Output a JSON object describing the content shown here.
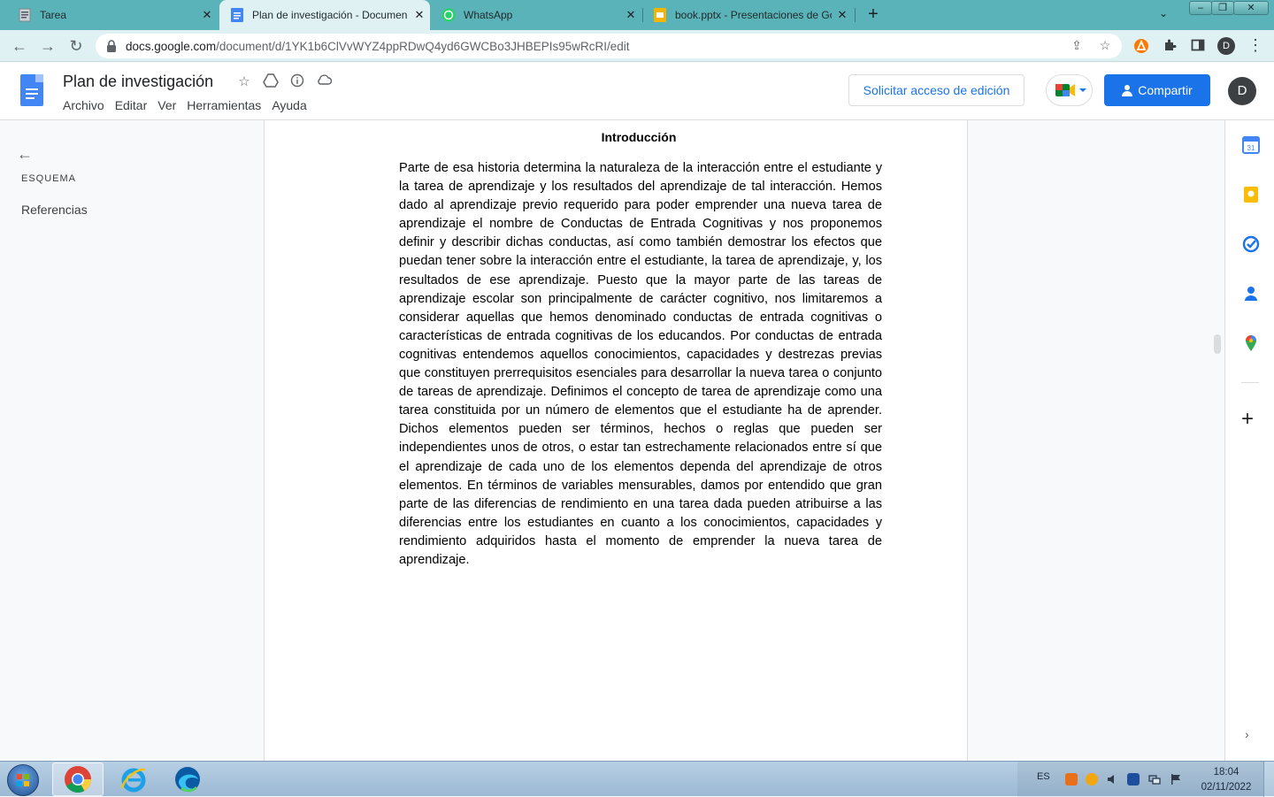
{
  "browser": {
    "tabs": [
      {
        "title": "Tarea",
        "active": false
      },
      {
        "title": "Plan de investigación - Documen",
        "active": true
      },
      {
        "title": "WhatsApp",
        "active": false
      },
      {
        "title": "book.pptx - Presentaciones de Go",
        "active": false
      }
    ],
    "close_glyph": "✕",
    "new_tab_glyph": "+",
    "address": {
      "domain": "docs.google.com",
      "path": "/document/d/1YK1b6ClVvWYZ4ppRDwQ4yd6GWCBo3JHBEPIs95wRcRI/edit"
    },
    "profile_initial": "D"
  },
  "docs": {
    "title": "Plan de investigación",
    "menu": [
      "Archivo",
      "Editar",
      "Ver",
      "Herramientas",
      "Ayuda"
    ],
    "request_edit_label": "Solicitar acceso de edición",
    "share_label": "Compartir",
    "avatar_initial": "D",
    "brand_color": "#1a73e8"
  },
  "outline": {
    "heading": "ESQUEMA",
    "items": [
      "Referencias"
    ]
  },
  "document": {
    "heading": "Introducción",
    "paragraph": "Parte de esa historia determina la naturaleza de la interacción entre el estudiante y la tarea de aprendizaje y los resultados del aprendizaje de tal interacción. Hemos dado al aprendizaje previo requerido para poder emprender una nueva tarea de aprendizaje el nombre de Conductas de Entrada Cognitivas y nos proponemos definir y describir dichas conductas, así como también demostrar los efectos que puedan tener sobre la interacción entre el estudiante, la tarea de aprendizaje, y, los resultados de ese aprendizaje. Puesto que la mayor parte de las tareas de aprendizaje escolar son principalmente de carácter cognitivo, nos limitaremos a considerar aquellas que hemos denominado conductas de entrada cognitivas o características de entrada cognitivas de los educandos. Por conductas de entrada cognitivas entendemos aquellos conocimientos, capacidades y destrezas previas que constituyen prerrequisitos esenciales para desarrollar la nueva tarea o conjunto de tareas de aprendizaje.  Definimos el concepto de tarea de aprendizaje como una tarea constituida por un número de elementos que el estudiante ha de aprender. Dichos elementos pueden ser términos, hechos o reglas que pueden ser independientes unos de otros, o estar tan estrechamente relacionados entre sí que el aprendizaje de cada uno de los elementos dependa del aprendizaje de otros elementos. En términos de variables mensurables, damos por entendido que gran parte de las diferencias de rendimiento en una tarea dada pueden atribuirse a las diferencias entre los estudiantes en cuanto a los conocimientos, capacidades y rendimiento adquiridos hasta el momento de emprender la nueva tarea de aprendizaje."
  },
  "taskbar": {
    "language": "ES",
    "time": "18:04",
    "date": "02/11/2022"
  }
}
